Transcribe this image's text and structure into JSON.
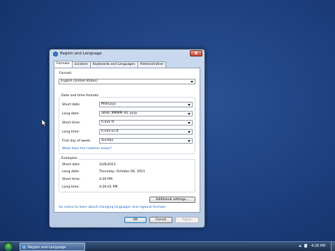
{
  "window": {
    "title": "Region and Language",
    "close_glyph": "x"
  },
  "tabs": [
    {
      "label": "Formats"
    },
    {
      "label": "Location"
    },
    {
      "label": "Keyboards and Languages"
    },
    {
      "label": "Administrative"
    }
  ],
  "format": {
    "label": "Format:",
    "value": "English (United States)"
  },
  "date_time": {
    "group_title": "Date and time formats",
    "short_date_label": "Short date:",
    "short_date_value": "M/d/yyyy",
    "long_date_label": "Long date:",
    "long_date_value": "dddd, MMMM dd, yyyy",
    "short_time_label": "Short time:",
    "short_time_value": "h:mm tt",
    "long_time_label": "Long time:",
    "long_time_value": "h:mm:ss tt",
    "first_day_label": "First day of week:",
    "first_day_value": "Sunday",
    "notation_link": "What does the notation mean?"
  },
  "examples": {
    "group_title": "Examples",
    "short_date_label": "Short date:",
    "short_date_value": "10/6/2011",
    "long_date_label": "Long date:",
    "long_date_value": "Thursday, October 06, 2011",
    "short_time_label": "Short time:",
    "short_time_value": "4:26 PM",
    "long_time_label": "Long time:",
    "long_time_value": "4:26:01 PM"
  },
  "additional_settings_label": "Additional settings...",
  "online_link": "Go online to learn about changing languages and regional formats",
  "buttons": {
    "ok": "OK",
    "cancel": "Cancel",
    "apply": "Apply"
  },
  "taskbar": {
    "task_label": "Region and Language",
    "clock": "4:26 PM"
  },
  "icons": {
    "title": "globe-icon",
    "start": "windows-orb-icon",
    "cursor": "mouse-pointer-icon"
  },
  "colors": {
    "desktop": "#1d3f7a",
    "link": "#1a5fc0"
  }
}
